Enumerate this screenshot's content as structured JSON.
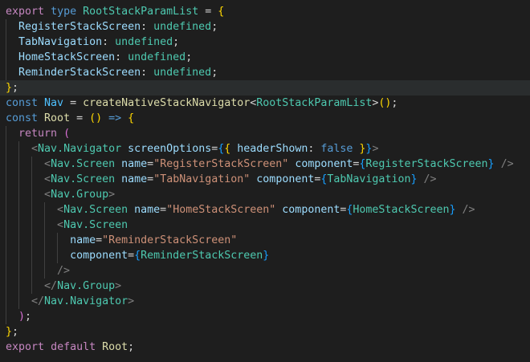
{
  "editor": {
    "language": "TypeScript (TSX)",
    "theme": "Dark+",
    "lines": [
      [
        [
          "export",
          "ctl"
        ],
        [
          " ",
          "pun"
        ],
        [
          "type",
          "kw"
        ],
        [
          " ",
          "pun"
        ],
        [
          "RootStackParamList",
          "ty"
        ],
        [
          " = ",
          "pun"
        ],
        [
          "{",
          "b1"
        ]
      ],
      [
        [
          "  ",
          "pun"
        ],
        [
          "RegisterStackScreen",
          "var"
        ],
        [
          ": ",
          "pun"
        ],
        [
          "undefined",
          "ty"
        ],
        [
          ";",
          "pun"
        ]
      ],
      [
        [
          "  ",
          "pun"
        ],
        [
          "TabNavigation",
          "var"
        ],
        [
          ": ",
          "pun"
        ],
        [
          "undefined",
          "ty"
        ],
        [
          ";",
          "pun"
        ]
      ],
      [
        [
          "  ",
          "pun"
        ],
        [
          "HomeStackScreen",
          "var"
        ],
        [
          ": ",
          "pun"
        ],
        [
          "undefined",
          "ty"
        ],
        [
          ";",
          "pun"
        ]
      ],
      [
        [
          "  ",
          "pun"
        ],
        [
          "ReminderStackScreen",
          "var"
        ],
        [
          ": ",
          "pun"
        ],
        [
          "undefined",
          "ty"
        ],
        [
          ";",
          "pun"
        ]
      ],
      [
        [
          "}",
          "b1"
        ],
        [
          ";",
          "pun"
        ]
      ],
      [
        [
          "const",
          "kw"
        ],
        [
          " ",
          "pun"
        ],
        [
          "Nav",
          "cst"
        ],
        [
          " = ",
          "pun"
        ],
        [
          "createNativeStackNavigator",
          "fn"
        ],
        [
          "<",
          "pun"
        ],
        [
          "RootStackParamList",
          "ty"
        ],
        [
          ">",
          "pun"
        ],
        [
          "()",
          "b1"
        ],
        [
          ";",
          "pun"
        ]
      ],
      [
        [
          "const",
          "kw"
        ],
        [
          " ",
          "pun"
        ],
        [
          "Root",
          "fn"
        ],
        [
          " = ",
          "pun"
        ],
        [
          "()",
          "b1"
        ],
        [
          " ",
          "pun"
        ],
        [
          "=>",
          "kw"
        ],
        [
          " ",
          "pun"
        ],
        [
          "{",
          "b1"
        ]
      ],
      [
        [
          "  ",
          "pun"
        ],
        [
          "return",
          "ctl"
        ],
        [
          " ",
          "pun"
        ],
        [
          "(",
          "b2"
        ]
      ],
      [
        [
          "    ",
          "pun"
        ],
        [
          "<",
          "tag"
        ],
        [
          "Nav.Navigator",
          "ty"
        ],
        [
          " ",
          "pun"
        ],
        [
          "screenOptions",
          "var"
        ],
        [
          "=",
          "pun"
        ],
        [
          "{",
          "b3"
        ],
        [
          "{",
          "b1"
        ],
        [
          " ",
          "pun"
        ],
        [
          "headerShown",
          "var"
        ],
        [
          ": ",
          "pun"
        ],
        [
          "false",
          "kw"
        ],
        [
          " ",
          "pun"
        ],
        [
          "}",
          "b1"
        ],
        [
          "}",
          "b3"
        ],
        [
          ">",
          "tag"
        ]
      ],
      [
        [
          "      ",
          "pun"
        ],
        [
          "<",
          "tag"
        ],
        [
          "Nav.Screen",
          "ty"
        ],
        [
          " ",
          "pun"
        ],
        [
          "name",
          "var"
        ],
        [
          "=",
          "pun"
        ],
        [
          "\"RegisterStackScreen\"",
          "str"
        ],
        [
          " ",
          "pun"
        ],
        [
          "component",
          "var"
        ],
        [
          "=",
          "pun"
        ],
        [
          "{",
          "b3"
        ],
        [
          "RegisterStackScreen",
          "ty"
        ],
        [
          "}",
          "b3"
        ],
        [
          " ",
          "pun"
        ],
        [
          "/>",
          "tag"
        ]
      ],
      [
        [
          "      ",
          "pun"
        ],
        [
          "<",
          "tag"
        ],
        [
          "Nav.Screen",
          "ty"
        ],
        [
          " ",
          "pun"
        ],
        [
          "name",
          "var"
        ],
        [
          "=",
          "pun"
        ],
        [
          "\"TabNavigation\"",
          "str"
        ],
        [
          " ",
          "pun"
        ],
        [
          "component",
          "var"
        ],
        [
          "=",
          "pun"
        ],
        [
          "{",
          "b3"
        ],
        [
          "TabNavigation",
          "ty"
        ],
        [
          "}",
          "b3"
        ],
        [
          " ",
          "pun"
        ],
        [
          "/>",
          "tag"
        ]
      ],
      [
        [
          "      ",
          "pun"
        ],
        [
          "<",
          "tag"
        ],
        [
          "Nav.Group",
          "ty"
        ],
        [
          ">",
          "tag"
        ]
      ],
      [
        [
          "        ",
          "pun"
        ],
        [
          "<",
          "tag"
        ],
        [
          "Nav.Screen",
          "ty"
        ],
        [
          " ",
          "pun"
        ],
        [
          "name",
          "var"
        ],
        [
          "=",
          "pun"
        ],
        [
          "\"HomeStackScreen\"",
          "str"
        ],
        [
          " ",
          "pun"
        ],
        [
          "component",
          "var"
        ],
        [
          "=",
          "pun"
        ],
        [
          "{",
          "b3"
        ],
        [
          "HomeStackScreen",
          "ty"
        ],
        [
          "}",
          "b3"
        ],
        [
          " ",
          "pun"
        ],
        [
          "/>",
          "tag"
        ]
      ],
      [
        [
          "        ",
          "pun"
        ],
        [
          "<",
          "tag"
        ],
        [
          "Nav.Screen",
          "ty"
        ]
      ],
      [
        [
          "          ",
          "pun"
        ],
        [
          "name",
          "var"
        ],
        [
          "=",
          "pun"
        ],
        [
          "\"ReminderStackScreen\"",
          "str"
        ]
      ],
      [
        [
          "          ",
          "pun"
        ],
        [
          "component",
          "var"
        ],
        [
          "=",
          "pun"
        ],
        [
          "{",
          "b3"
        ],
        [
          "ReminderStackScreen",
          "ty"
        ],
        [
          "}",
          "b3"
        ]
      ],
      [
        [
          "        ",
          "pun"
        ],
        [
          "/>",
          "tag"
        ]
      ],
      [
        [
          "      ",
          "pun"
        ],
        [
          "</",
          "tag"
        ],
        [
          "Nav.Group",
          "ty"
        ],
        [
          ">",
          "tag"
        ]
      ],
      [
        [
          "    ",
          "pun"
        ],
        [
          "</",
          "tag"
        ],
        [
          "Nav.Navigator",
          "ty"
        ],
        [
          ">",
          "tag"
        ]
      ],
      [
        [
          "  ",
          "pun"
        ],
        [
          ")",
          "b2"
        ],
        [
          ";",
          "pun"
        ]
      ],
      [
        [
          "}",
          "b1"
        ],
        [
          ";",
          "pun"
        ]
      ],
      [
        [
          "export",
          "ctl"
        ],
        [
          " ",
          "pun"
        ],
        [
          "default",
          "ctl"
        ],
        [
          " ",
          "pun"
        ],
        [
          "Root",
          "fn"
        ],
        [
          ";",
          "pun"
        ]
      ]
    ],
    "highlighted_line": 5,
    "colors": {
      "background": "#1e1e1e",
      "keyword": "#569cd6",
      "control": "#c586c0",
      "type": "#4ec9b0",
      "variable": "#9cdcfe",
      "constant": "#4fc1ff",
      "function": "#dcdcaa",
      "string": "#ce9178",
      "jsx_bracket": "#808080",
      "bracket_level_1": "#ffd700",
      "bracket_level_2": "#da70d6",
      "bracket_level_3": "#179fff"
    }
  }
}
